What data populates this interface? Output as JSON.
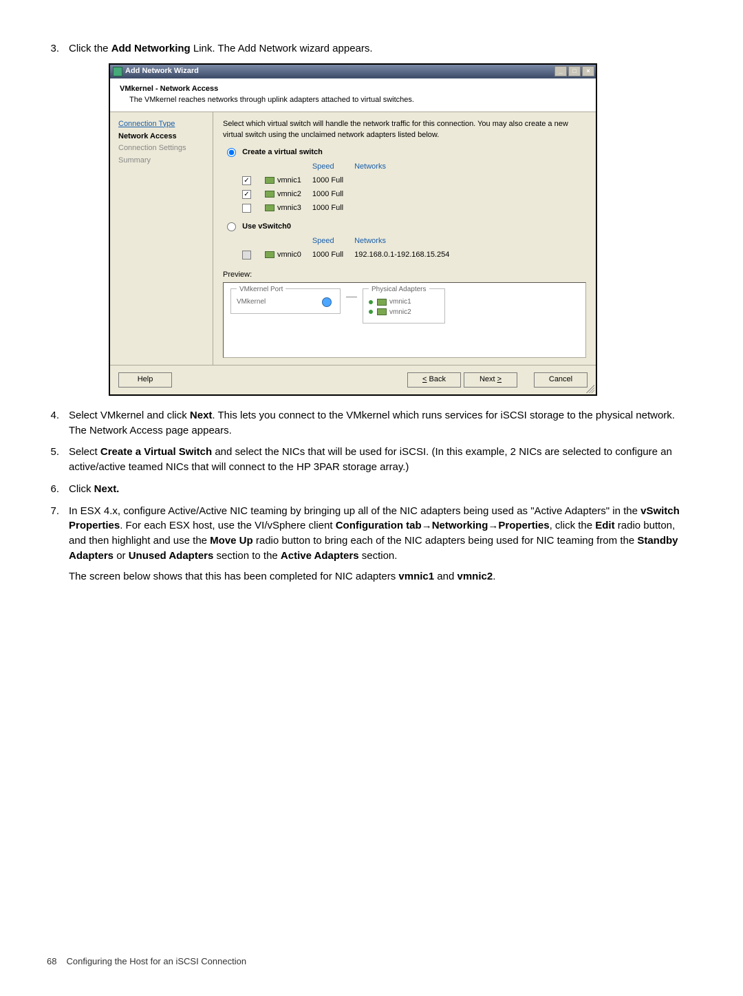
{
  "steps": {
    "s3_num": "3.",
    "s3_pre": "Click the ",
    "s3_bold": "Add Networking",
    "s3_post": " Link. The Add Network wizard appears.",
    "s4_num": "4.",
    "s4_pre": "Select VMkernel and click ",
    "s4_bold": "Next",
    "s4_post": ". This lets you connect to the VMkernel which runs services for iSCSI storage to the physical network. The Network Access page appears.",
    "s5_num": "5.",
    "s5_pre": "Select ",
    "s5_bold": "Create a Virtual Switch",
    "s5_post": " and select the NICs that will be used for iSCSI. (In this example, 2 NICs are selected to configure an active/active teamed NICs that will connect to the HP 3PAR storage array.)",
    "s6_num": "6.",
    "s6_pre": "Click ",
    "s6_bold": "Next.",
    "s7_num": "7.",
    "s7_a": "In ESX 4.x, configure Active/Active NIC teaming by bringing up all of the NIC adapters being used as \"Active Adapters\" in the ",
    "s7_b1": "vSwitch Properties",
    "s7_c": ". For each ESX host, use the VI/vSphere client ",
    "s7_b2": "Configuration tab",
    "s7_arrow1": "→",
    "s7_b3": "Networking",
    "s7_arrow2": "→",
    "s7_b4": "Properties",
    "s7_d": ", click the ",
    "s7_b5": "Edit",
    "s7_e": " radio button, and then highlight and use the ",
    "s7_b6": "Move Up",
    "s7_f": " radio button to bring each of the NIC adapters being used for NIC teaming from the ",
    "s7_b7": "Standby Adapters",
    "s7_g": " or ",
    "s7_b8": "Unused Adapters",
    "s7_h": " section to the ",
    "s7_b9": "Active Adapters",
    "s7_i": " section.",
    "s7_para2a": "The screen below shows that this has been completed for NIC adapters ",
    "s7_para2b1": "vmnic1",
    "s7_para2c": " and ",
    "s7_para2b2": "vmnic2",
    "s7_para2d": "."
  },
  "wizard": {
    "title": "Add Network Wizard",
    "header_title": "VMkernel - Network Access",
    "header_sub": "The VMkernel reaches networks through uplink adapters attached to virtual switches.",
    "side": {
      "s1": "Connection Type",
      "s2": "Network Access",
      "s3": "Connection Settings",
      "s4": "Summary"
    },
    "intro": "Select which virtual switch will handle the network traffic for this connection. You may also create a new virtual switch using the unclaimed network adapters listed below.",
    "opt1": "Create a virtual switch",
    "opt2": "Use vSwitch0",
    "col_speed": "Speed",
    "col_networks": "Networks",
    "nics1": [
      {
        "name": "vmnic1",
        "speed": "1000 Full",
        "checked": true
      },
      {
        "name": "vmnic2",
        "speed": "1000 Full",
        "checked": true
      },
      {
        "name": "vmnic3",
        "speed": "1000 Full",
        "checked": false
      }
    ],
    "nics2": [
      {
        "name": "vmnic0",
        "speed": "1000 Full",
        "net": "192.168.0.1-192.168.15.254",
        "checked": false
      }
    ],
    "preview_label": "Preview:",
    "pv_group1": "VMkernel Port",
    "pv_item1": "VMkernel",
    "pv_group2": "Physical Adapters",
    "pv_pa1": "vmnic1",
    "pv_pa2": "vmnic2",
    "btn_help": "Help",
    "btn_back_u": "<",
    "btn_back": " Back",
    "btn_next": "Next ",
    "btn_next_u": ">",
    "btn_cancel": "Cancel"
  },
  "footer": {
    "page": "68",
    "section": "Configuring the Host for an iSCSI Connection"
  }
}
